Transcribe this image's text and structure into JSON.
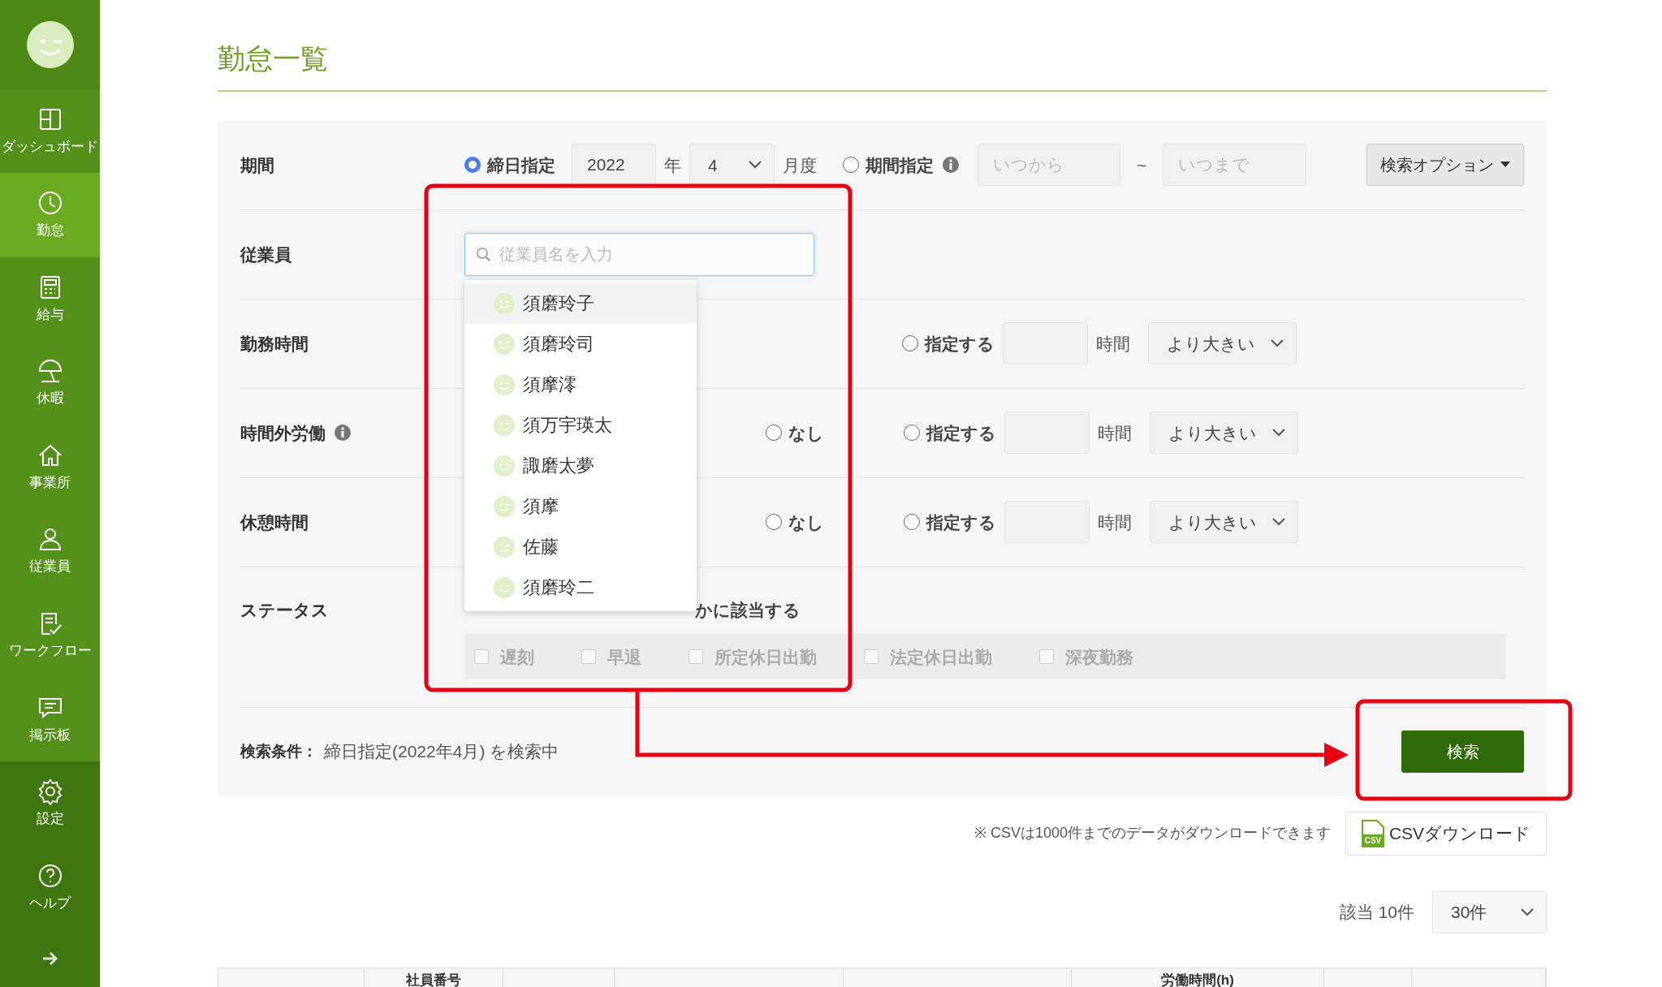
{
  "sidebar": {
    "items": [
      {
        "label": "ダッシュボード",
        "selected": false
      },
      {
        "label": "勤怠",
        "selected": true
      },
      {
        "label": "給与",
        "selected": false
      },
      {
        "label": "休暇",
        "selected": false
      },
      {
        "label": "事業所",
        "selected": false
      },
      {
        "label": "従業員",
        "selected": false
      },
      {
        "label": "ワークフロー",
        "selected": false
      },
      {
        "label": "掲示板",
        "selected": false
      },
      {
        "label": "設定",
        "selected": false
      },
      {
        "label": "ヘルプ",
        "selected": false
      }
    ]
  },
  "page_title": "勤怠一覧",
  "filters": {
    "period": {
      "label": "期間",
      "closing_option": {
        "label": "締日指定",
        "selected": true
      },
      "year": "2022",
      "year_unit": "年",
      "month": "4",
      "month_unit": "月度",
      "range_option": {
        "label": "期間指定",
        "selected": false
      },
      "from_placeholder": "いつから",
      "separator": "~",
      "to_placeholder": "いつまで"
    },
    "search_options_button": "検索オプション",
    "employee": {
      "label": "従業員",
      "placeholder": "従業員名を入力",
      "suggestions": [
        {
          "name": "須磨玲子",
          "selected": true
        },
        {
          "name": "須磨玲司",
          "selected": false
        },
        {
          "name": "須摩澪",
          "selected": false
        },
        {
          "name": "須万宇瑛太",
          "selected": false
        },
        {
          "name": "諏磨太夢",
          "selected": false
        },
        {
          "name": "須摩",
          "selected": false
        },
        {
          "name": "佐藤",
          "selected": false
        },
        {
          "name": "須磨玲二",
          "selected": false
        }
      ]
    },
    "time_rows": [
      {
        "label": "勤務時間",
        "info": false,
        "specify": {
          "label": "指定する",
          "selected": false
        },
        "unit": "時間",
        "comparison": "より大きい"
      },
      {
        "label": "時間外労働",
        "info": true,
        "none": {
          "label": "なし",
          "selected": false
        },
        "specify": {
          "label": "指定する",
          "selected": false
        },
        "unit": "時間",
        "comparison": "より大きい"
      },
      {
        "label": "休憩時間",
        "info": false,
        "none": {
          "label": "なし",
          "selected": false
        },
        "specify": {
          "label": "指定する",
          "selected": false
        },
        "unit": "時間",
        "comparison": "より大きい"
      }
    ],
    "status": {
      "label": "ステータス",
      "match_text": "かに該当する",
      "options": [
        {
          "label": "遅刻",
          "checked": false,
          "disabled": true
        },
        {
          "label": "早退",
          "checked": false,
          "disabled": true
        },
        {
          "label": "所定休日出勤",
          "checked": false,
          "disabled": true
        },
        {
          "label": "法定休日出勤",
          "checked": false,
          "disabled": true
        },
        {
          "label": "深夜勤務",
          "checked": false,
          "disabled": true
        }
      ]
    },
    "condition": {
      "label": "検索条件：",
      "text": "締日指定(2022年4月) を検索中"
    },
    "search_button": "検索"
  },
  "csv": {
    "note": "※ CSVは1000件までのデータがダウンロードできます",
    "icon_label": "CSV",
    "button": "CSVダウンロード"
  },
  "results": {
    "count": "該当 10件",
    "per_page": "30件"
  },
  "table": {
    "columns": [
      {},
      {
        "heading": "社員番号"
      },
      {},
      {},
      {},
      {
        "heading": "労働時間(h)"
      },
      {},
      {}
    ]
  }
}
